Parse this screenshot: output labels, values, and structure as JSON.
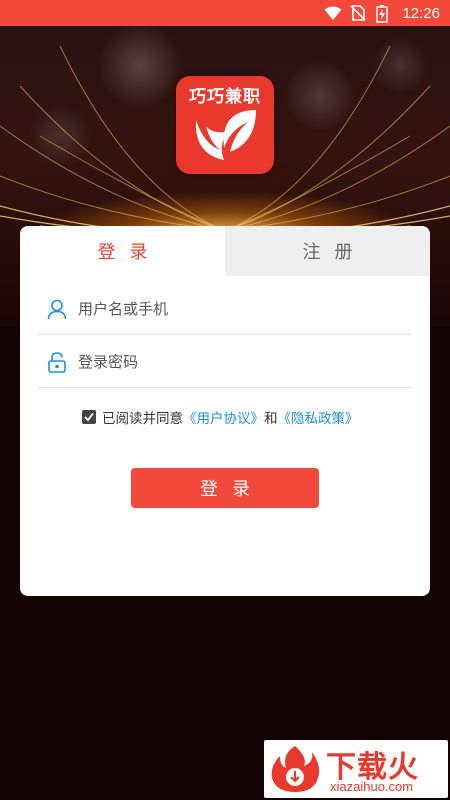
{
  "status_bar": {
    "time": "12:26",
    "bg_color": "#f2493b"
  },
  "app": {
    "logo_text": "巧巧兼职",
    "brand_color": "#e9382c"
  },
  "tabs": [
    {
      "label": "登录",
      "active": true
    },
    {
      "label": "注册",
      "active": false
    }
  ],
  "form": {
    "username_placeholder": "用户名或手机",
    "password_placeholder": "登录密码",
    "agree_checked": true,
    "agree_text": "已阅读并同意",
    "user_agreement": "《用户协议》",
    "and_text": "和",
    "privacy_policy": "《隐私政策》",
    "login_label": "登录"
  },
  "colors": {
    "accent": "#ef4136",
    "link": "#1a8fe3"
  },
  "watermark": {
    "title": "下载火",
    "subtitle": "xiazaihuo.com"
  }
}
